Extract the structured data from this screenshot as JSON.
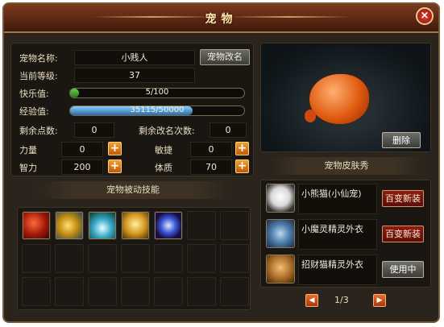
{
  "window": {
    "title": "宠物",
    "close_label": "×"
  },
  "info": {
    "name_label": "宠物名称:",
    "name_value": "小贱人",
    "rename_button": "宠物改名",
    "level_label": "当前等级:",
    "level_value": "37",
    "happiness_label": "快乐值:",
    "happiness_text": "5/100",
    "happiness_fraction": 0.05,
    "exp_label": "经验值:",
    "exp_text": "35115/50000",
    "exp_fraction": 0.7023,
    "points_label": "剩余点数:",
    "points_value": "0",
    "rename_left_label": "剩余改名次数:",
    "rename_left_value": "0"
  },
  "stats": [
    {
      "label": "力量",
      "value": "0"
    },
    {
      "label": "敏捷",
      "value": "0"
    },
    {
      "label": "智力",
      "value": "200"
    },
    {
      "label": "体质",
      "value": "70"
    }
  ],
  "plus_label": "+",
  "passive_skills": {
    "header": "宠物被动技能",
    "icons": [
      "red-fist-skill-icon",
      "golden-fish-skill-icon",
      "ice-crystal-skill-icon",
      "golden-bowl-skill-icon",
      "blue-vortex-skill-icon"
    ]
  },
  "preview": {
    "delete_button": "删除"
  },
  "skins": {
    "header": "宠物皮肤秀",
    "items": [
      {
        "name": "小熊猫(小仙宠)",
        "button": "百变新装",
        "icon": "panda-icon"
      },
      {
        "name": "小魔灵精灵外衣",
        "button": "百变新装",
        "icon": "spirit-scroll-icon"
      },
      {
        "name": "招财猫精灵外衣",
        "button": "使用中",
        "icon": "lucky-cat-icon"
      }
    ],
    "page": "1/3",
    "prev_label": "◀",
    "next_label": "▶"
  },
  "colors": {
    "happiness_fill": "#3c8a2a",
    "exp_fill": "#3a8ac8",
    "accent_orange": "#e8702a"
  }
}
